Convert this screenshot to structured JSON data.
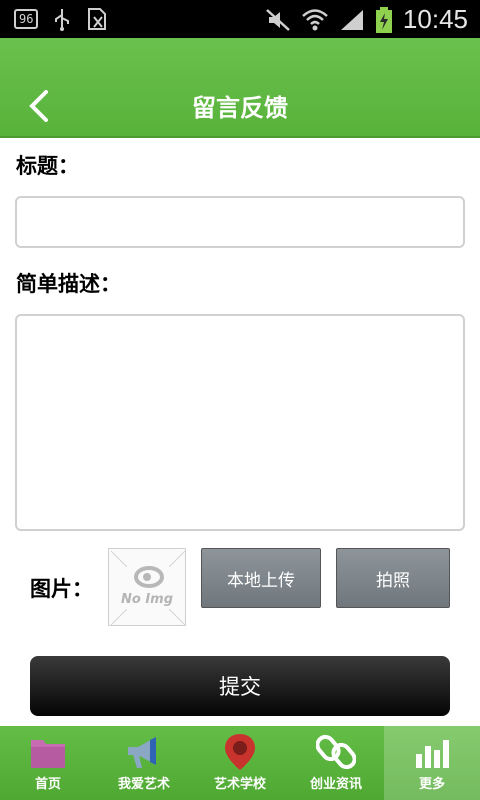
{
  "status_bar": {
    "badge": "96",
    "time": "10:45",
    "icons": [
      "usb-icon",
      "sim-card-icon",
      "mute-icon",
      "wifi-icon",
      "signal-icon",
      "battery-charging-icon"
    ]
  },
  "header": {
    "title": "留言反馈",
    "back_icon": "chevron-left-icon"
  },
  "form": {
    "title_label": "标题：",
    "title_value": "",
    "description_label": "简单描述：",
    "description_value": "",
    "image_label": "图片：",
    "no_image_text": "No Img",
    "local_upload_label": "本地上传",
    "take_photo_label": "拍照",
    "submit_label": "提交"
  },
  "bottom_nav": {
    "items": [
      {
        "label": "首页",
        "icon": "folder-icon"
      },
      {
        "label": "我爱艺术",
        "icon": "megaphone-icon"
      },
      {
        "label": "艺术学校",
        "icon": "location-pin-icon"
      },
      {
        "label": "创业资讯",
        "icon": "chain-link-icon"
      },
      {
        "label": "更多",
        "icon": "bar-chart-icon"
      }
    ]
  },
  "colors": {
    "brand_green": "#5cb73f",
    "header_text": "#ffffff",
    "button_gray": "#7d858a",
    "submit_black": "#111111"
  }
}
